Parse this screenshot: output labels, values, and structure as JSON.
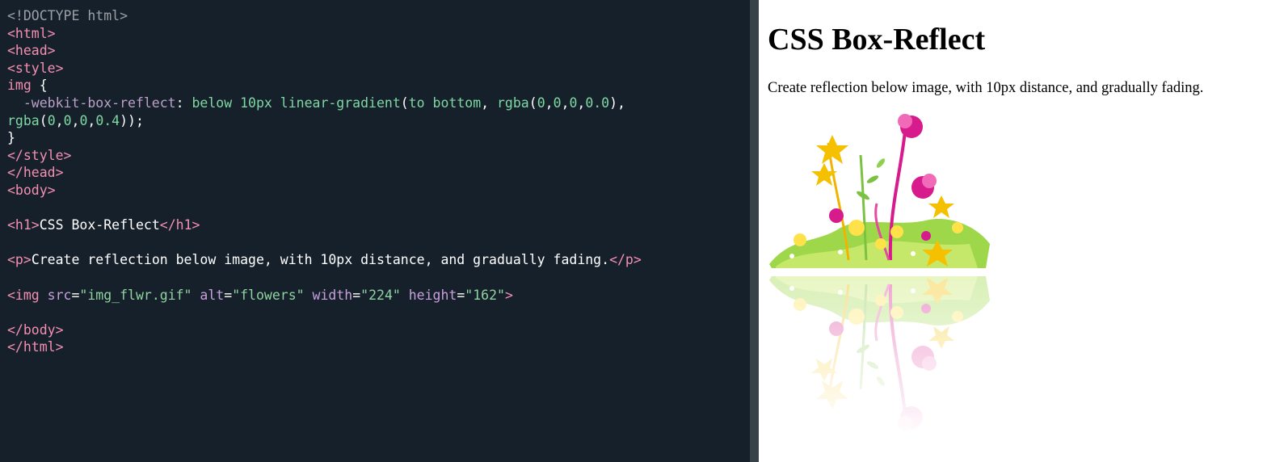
{
  "editor": {
    "lines": [
      [
        {
          "t": "doctype",
          "v": "<!DOCTYPE html>"
        }
      ],
      [
        {
          "t": "tag",
          "v": "<html>"
        }
      ],
      [
        {
          "t": "tag",
          "v": "<head>"
        }
      ],
      [
        {
          "t": "tag",
          "v": "<style>"
        }
      ],
      [
        {
          "t": "sel",
          "v": "img "
        },
        {
          "t": "punct",
          "v": "{"
        }
      ],
      [
        {
          "t": "prop",
          "v": "  -webkit-box-reflect"
        },
        {
          "t": "punct",
          "v": ": "
        },
        {
          "t": "val",
          "v": "below 10px linear-gradient"
        },
        {
          "t": "punct",
          "v": "("
        },
        {
          "t": "val",
          "v": "to bottom"
        },
        {
          "t": "punct",
          "v": ", "
        },
        {
          "t": "val",
          "v": "rgba"
        },
        {
          "t": "punct",
          "v": "("
        },
        {
          "t": "num",
          "v": "0"
        },
        {
          "t": "punct",
          "v": ","
        },
        {
          "t": "num",
          "v": "0"
        },
        {
          "t": "punct",
          "v": ","
        },
        {
          "t": "num",
          "v": "0"
        },
        {
          "t": "punct",
          "v": ","
        },
        {
          "t": "num",
          "v": "0.0"
        },
        {
          "t": "punct",
          "v": "),"
        }
      ],
      [
        {
          "t": "val",
          "v": "rgba"
        },
        {
          "t": "punct",
          "v": "("
        },
        {
          "t": "num",
          "v": "0"
        },
        {
          "t": "punct",
          "v": ","
        },
        {
          "t": "num",
          "v": "0"
        },
        {
          "t": "punct",
          "v": ","
        },
        {
          "t": "num",
          "v": "0"
        },
        {
          "t": "punct",
          "v": ","
        },
        {
          "t": "num",
          "v": "0.4"
        },
        {
          "t": "punct",
          "v": "));"
        }
      ],
      [
        {
          "t": "punct",
          "v": "}"
        }
      ],
      [
        {
          "t": "tag",
          "v": "</style>"
        }
      ],
      [
        {
          "t": "tag",
          "v": "</head>"
        }
      ],
      [
        {
          "t": "tag",
          "v": "<body>"
        }
      ],
      [],
      [
        {
          "t": "tag",
          "v": "<h1>"
        },
        {
          "t": "text",
          "v": "CSS Box-Reflect"
        },
        {
          "t": "tag",
          "v": "</h1>"
        }
      ],
      [],
      [
        {
          "t": "tag",
          "v": "<p>"
        },
        {
          "t": "text",
          "v": "Create reflection below image, with 10px distance, and gradually fading."
        },
        {
          "t": "tag",
          "v": "</p>"
        }
      ],
      [],
      [
        {
          "t": "tag",
          "v": "<img "
        },
        {
          "t": "attr",
          "v": "src"
        },
        {
          "t": "punct",
          "v": "="
        },
        {
          "t": "str",
          "v": "\"img_flwr.gif\""
        },
        {
          "t": "attr",
          "v": " alt"
        },
        {
          "t": "punct",
          "v": "="
        },
        {
          "t": "str",
          "v": "\"flowers\""
        },
        {
          "t": "attr",
          "v": " width"
        },
        {
          "t": "punct",
          "v": "="
        },
        {
          "t": "str",
          "v": "\"224\""
        },
        {
          "t": "attr",
          "v": " height"
        },
        {
          "t": "punct",
          "v": "="
        },
        {
          "t": "str",
          "v": "\"162\""
        },
        {
          "t": "tag",
          "v": ">"
        }
      ],
      [],
      [
        {
          "t": "tag",
          "v": "</body>"
        }
      ],
      [
        {
          "t": "tag",
          "v": "</html>"
        }
      ]
    ]
  },
  "preview": {
    "heading": "CSS Box-Reflect",
    "paragraph": "Create reflection below image, with 10px distance, and gradually fading.",
    "image_label": "flowers"
  },
  "colors": {
    "editor_bg": "#16202b",
    "tag": "#f48fb1",
    "value": "#7ed8a2",
    "splitter": "#384048"
  }
}
